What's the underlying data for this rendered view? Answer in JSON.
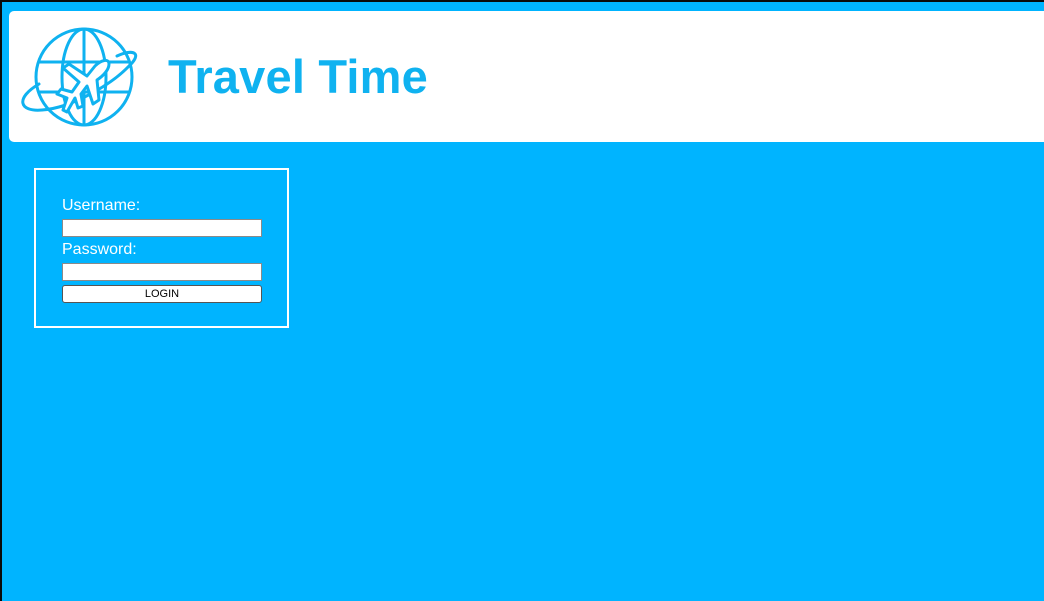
{
  "header": {
    "title": "Travel Time",
    "logo_icon": "globe-airplane-icon"
  },
  "login": {
    "username_label": "Username:",
    "username_value": "",
    "password_label": "Password:",
    "password_value": "",
    "button_label": "LOGIN"
  },
  "colors": {
    "background": "#00b4ff",
    "brand": "#0fb2f0",
    "header_bg": "#ffffff"
  }
}
